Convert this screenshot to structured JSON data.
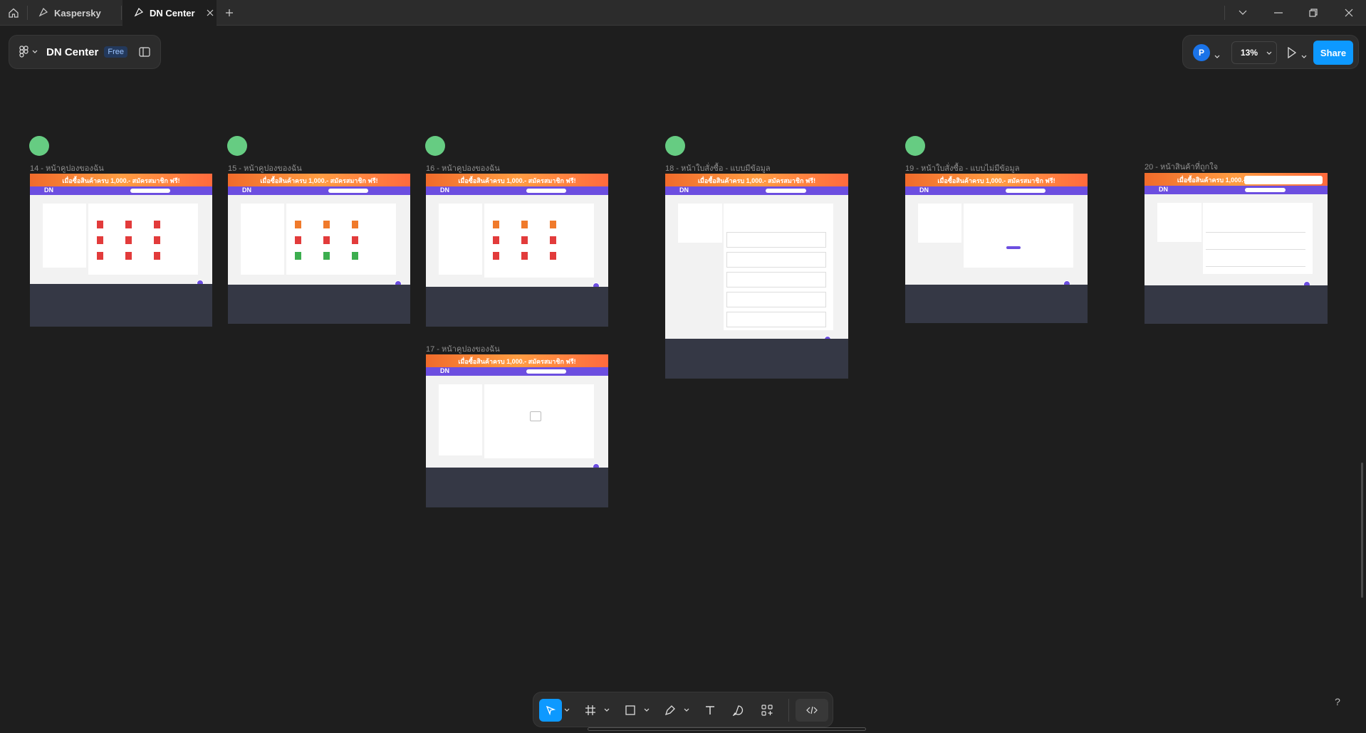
{
  "tabs": [
    {
      "label": "Kaspersky",
      "active": false
    },
    {
      "label": "DN Center",
      "active": true
    }
  ],
  "file": {
    "name": "DN Center",
    "plan_badge": "Free"
  },
  "user": {
    "avatar_initial": "P"
  },
  "zoom": "13%",
  "share_label": "Share",
  "frames": [
    {
      "label": "14 - หน้าคูปองของฉัน"
    },
    {
      "label": "15 - หน้าคูปองของฉัน"
    },
    {
      "label": "16 - หน้าคูปองของฉัน"
    },
    {
      "label": "17 - หน้าคูปองของฉัน"
    },
    {
      "label": "18 - หน้าใบสั่งซื้อ - แบบมีข้อมูล"
    },
    {
      "label": "19 - หน้าใบสั่งซื้อ - แบบไม่มีข้อมูล"
    },
    {
      "label": "20 - หน้าสินค้าที่ถูกใจ"
    }
  ],
  "banner": {
    "text": "เมื่อซื้อสินค้าครบ 1,000.- สมัครสมาชิก ฟรี!"
  },
  "brand": {
    "logo": "DN"
  },
  "help_label": "?",
  "colors": {
    "accent": "#0d99ff",
    "frame_marker": "#66cc82",
    "brand_purple": "#6c4ee0",
    "banner_orange": "#f06b2b",
    "footer": "#353845"
  }
}
